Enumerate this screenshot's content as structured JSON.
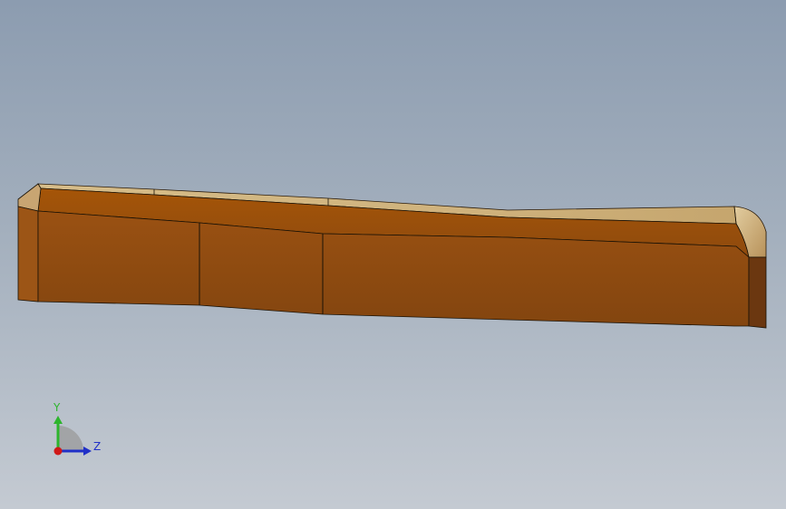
{
  "viewport": {
    "part_colors": {
      "top_face": "#c9ad7a",
      "top_face_light": "#d8bf8c",
      "front_face": "#8c4a10",
      "front_face_light": "#a5560f",
      "upper_band": "#9a4f0c",
      "end_face": "#6b3710",
      "edge": "#1a1206"
    },
    "triad": {
      "y_label": "Y",
      "z_label": "Z",
      "y_color": "#2db52d",
      "z_color": "#2030c8",
      "x_color": "#d01818"
    }
  }
}
